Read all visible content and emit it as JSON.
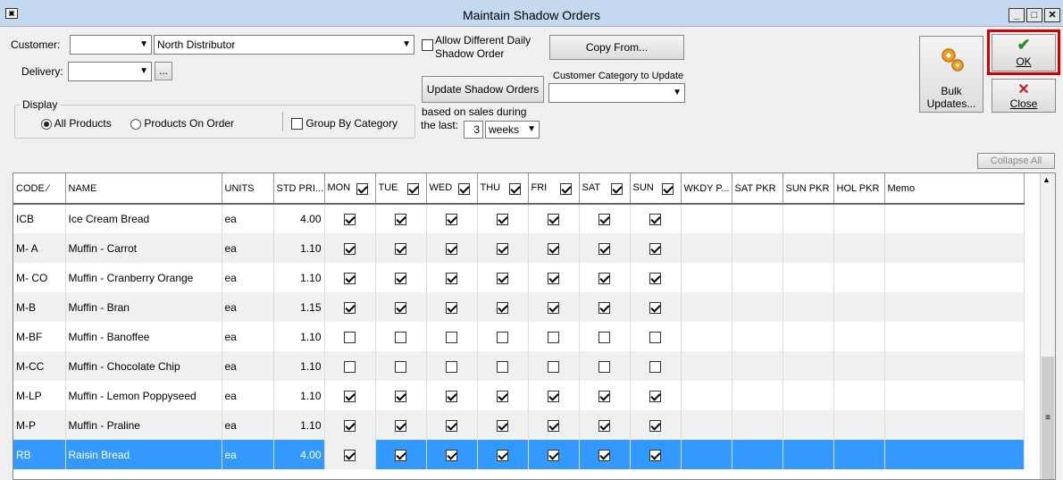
{
  "window": {
    "title": "Maintain Shadow Orders"
  },
  "form": {
    "customer_label": "Customer:",
    "customer_code": "",
    "customer_name": "North Distributor",
    "delivery_label": "Delivery:",
    "delivery_value": "",
    "ellipsis_label": "...",
    "allow_diff_label_1": "Allow Different Daily",
    "allow_diff_label_2": "Shadow Order",
    "copy_from_label": "Copy From...",
    "update_shadow_label": "Update Shadow Orders",
    "customer_category_label": "Customer Category to Update",
    "customer_category_value": "",
    "based_on_1": "based on sales during",
    "based_on_2": "the last:",
    "last_n": "3",
    "period": "weeks",
    "display_legend": "Display",
    "all_products_label": "All Products",
    "products_on_order_label": "Products On Order",
    "group_by_label": "Group By Category"
  },
  "buttons": {
    "bulk_updates_1": "Bulk",
    "bulk_updates_2": "Updates...",
    "ok": "OK",
    "close": "Close",
    "collapse_all": "Collapse All"
  },
  "grid": {
    "headers": [
      "CODE ⁄",
      "NAME",
      "UNITS",
      "STD PRI...",
      "MON",
      "TUE",
      "WED",
      "THU",
      "FRI",
      "SAT",
      "SUN",
      "WKDY P...",
      "SAT PKR",
      "SUN PKR",
      "HOL PKR",
      "Memo"
    ],
    "rows": [
      {
        "code": "ICB",
        "name": "Ice Cream Bread",
        "units": "ea",
        "price": "4.00",
        "days": [
          true,
          true,
          true,
          true,
          true,
          true,
          true
        ]
      },
      {
        "code": "M- A",
        "name": "Muffin - Carrot",
        "units": "ea",
        "price": "1.10",
        "days": [
          true,
          true,
          true,
          true,
          true,
          true,
          true
        ]
      },
      {
        "code": "M- CO",
        "name": "Muffin - Cranberry Orange",
        "units": "ea",
        "price": "1.10",
        "days": [
          true,
          true,
          true,
          true,
          true,
          true,
          true
        ]
      },
      {
        "code": "M-B",
        "name": "Muffin - Bran",
        "units": "ea",
        "price": "1.15",
        "days": [
          true,
          true,
          true,
          true,
          true,
          true,
          true
        ]
      },
      {
        "code": "M-BF",
        "name": "Muffin - Banoffee",
        "units": "ea",
        "price": "1.10",
        "days": [
          false,
          false,
          false,
          false,
          false,
          false,
          false
        ]
      },
      {
        "code": "M-CC",
        "name": "Muffin - Chocolate Chip",
        "units": "ea",
        "price": "1.10",
        "days": [
          false,
          false,
          false,
          false,
          false,
          false,
          false
        ]
      },
      {
        "code": "M-LP",
        "name": "Muffin - Lemon Poppyseed",
        "units": "ea",
        "price": "1.10",
        "days": [
          true,
          true,
          true,
          true,
          true,
          true,
          true
        ]
      },
      {
        "code": "M-P",
        "name": "Muffin - Praline",
        "units": "ea",
        "price": "1.10",
        "days": [
          true,
          true,
          true,
          true,
          true,
          true,
          true
        ]
      },
      {
        "code": "RB",
        "name": "Raisin Bread",
        "units": "ea",
        "price": "4.00",
        "days": [
          true,
          true,
          true,
          true,
          true,
          true,
          true
        ]
      }
    ]
  },
  "icons": [
    "app-icon",
    "minimize-icon",
    "restore-icon",
    "close-window-icon",
    "gears-icon",
    "checkmark-icon",
    "x-icon"
  ],
  "colors": {
    "selection": "#3399ff",
    "ok_check": "#2e8b2e",
    "close_x": "#c0202a",
    "highlight_border": "#d00000"
  }
}
